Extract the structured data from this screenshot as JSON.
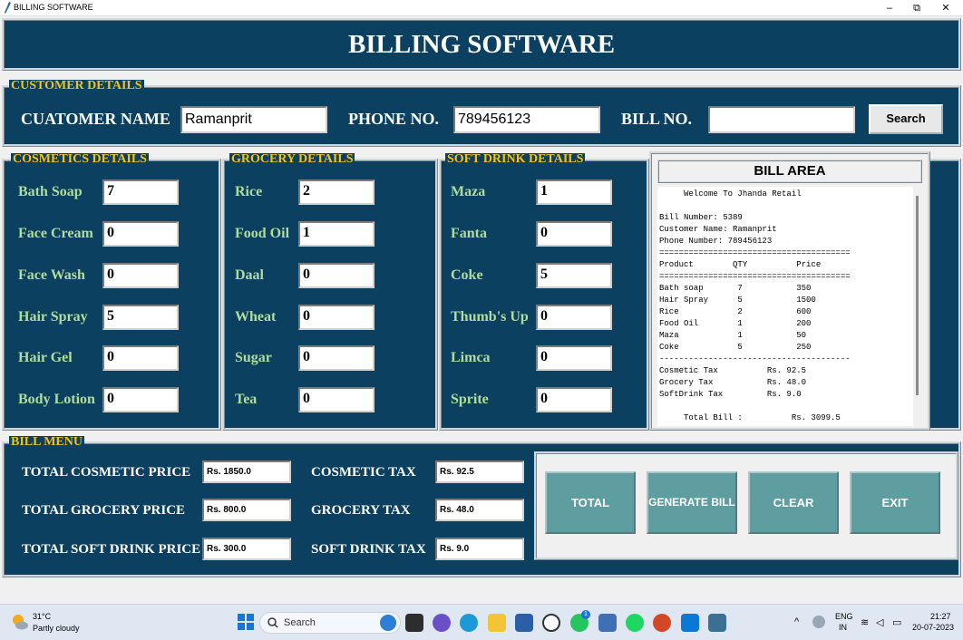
{
  "window": {
    "title": "BILLING SOFTWARE",
    "minimize": "–",
    "maximize": "⧉",
    "close": "✕"
  },
  "banner": "BILLING SOFTWARE",
  "customer": {
    "legend": "CUSTOMER DETAILS",
    "name_label": "CUATOMER NAME",
    "name_value": "Ramanprit",
    "phone_label": "PHONE NO.",
    "phone_value": "789456123",
    "bill_label": "BILL NO.",
    "bill_value": "",
    "search_label": "Search"
  },
  "cosmetics": {
    "legend": "COSMETICS DETAILS",
    "items": [
      {
        "label": "Bath Soap",
        "qty": "7"
      },
      {
        "label": "Face Cream",
        "qty": "0"
      },
      {
        "label": "Face Wash",
        "qty": "0"
      },
      {
        "label": "Hair Spray",
        "qty": "5"
      },
      {
        "label": "Hair Gel",
        "qty": "0"
      },
      {
        "label": "Body Lotion",
        "qty": "0"
      }
    ]
  },
  "grocery": {
    "legend": "GROCERY DETAILS",
    "items": [
      {
        "label": "Rice",
        "qty": "2"
      },
      {
        "label": "Food Oil",
        "qty": "1"
      },
      {
        "label": "Daal",
        "qty": "0"
      },
      {
        "label": "Wheat",
        "qty": "0"
      },
      {
        "label": "Sugar",
        "qty": "0"
      },
      {
        "label": "Tea",
        "qty": "0"
      }
    ]
  },
  "softdrink": {
    "legend": "SOFT DRINK DETAILS",
    "items": [
      {
        "label": "Maza",
        "qty": "1"
      },
      {
        "label": "Fanta",
        "qty": "0"
      },
      {
        "label": "Coke",
        "qty": "5"
      },
      {
        "label": "Thumb's Up",
        "qty": "0"
      },
      {
        "label": "Limca",
        "qty": "0"
      },
      {
        "label": "Sprite",
        "qty": "0"
      }
    ]
  },
  "bill_area": {
    "title": "BILL AREA",
    "lines": [
      "     Welcome To Jhanda Retail",
      "",
      "Bill Number: 5389",
      "Customer Name: Ramanprit",
      "Phone Number: 789456123",
      "=======================================",
      "Product        QTY          Price",
      "=======================================",
      "Bath soap       7           350",
      "Hair Spray      5           1500",
      "Rice            2           600",
      "Food Oil        1           200",
      "Maza            1           50",
      "Coke            5           250",
      "---------------------------------------",
      "Cosmetic Tax          Rs. 92.5",
      "Grocery Tax           Rs. 48.0",
      "SoftDrink Tax         Rs. 9.0",
      "",
      "     Total Bill :          Rs. 3099.5"
    ]
  },
  "bill_menu": {
    "legend": "BILL MENU",
    "total_cosmetic_label": "TOTAL COSMETIC PRICE",
    "total_cosmetic_value": "Rs. 1850.0",
    "total_grocery_label": "TOTAL GROCERY PRICE",
    "total_grocery_value": "Rs. 800.0",
    "total_softdrink_label": "TOTAL SOFT DRINK PRICE",
    "total_softdrink_value": "Rs. 300.0",
    "cosmetic_tax_label": "COSMETIC TAX",
    "cosmetic_tax_value": "Rs. 92.5",
    "grocery_tax_label": "GROCERY TAX",
    "grocery_tax_value": "Rs. 48.0",
    "softdrink_tax_label": "SOFT DRINK TAX",
    "softdrink_tax_value": "Rs. 9.0",
    "buttons": {
      "total": "TOTAL",
      "generate": "GENERATE BILL",
      "clear": "CLEAR",
      "exit": "EXIT"
    }
  },
  "taskbar": {
    "weather_temp": "31°C",
    "weather_desc": "Partly cloudy",
    "search": "Search",
    "lang_top": "ENG",
    "lang_bottom": "IN",
    "time": "21:27",
    "date": "20-07-2023",
    "badge": "1"
  },
  "colors": {
    "panel_bg": "#0c4060",
    "legend": "#f2c21b",
    "button": "#5f9ea0",
    "item_label": "#b0dc9c"
  }
}
